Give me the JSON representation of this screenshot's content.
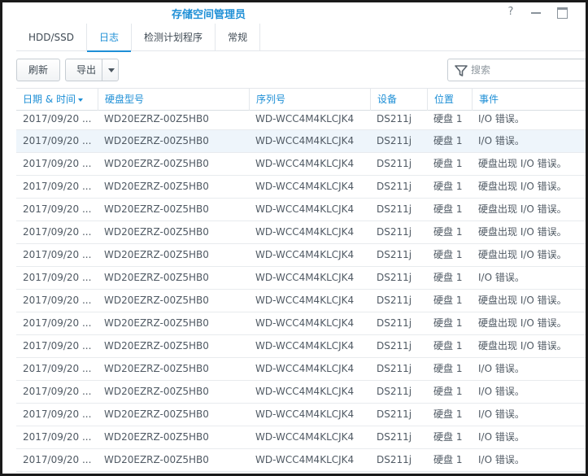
{
  "window": {
    "title": "存储空间管理员",
    "help_glyph": "?"
  },
  "tabs": [
    {
      "label": "HDD/SSD",
      "active": false
    },
    {
      "label": "日志",
      "active": true
    },
    {
      "label": "检测计划程序",
      "active": false
    },
    {
      "label": "常规",
      "active": false
    }
  ],
  "toolbar": {
    "refresh_label": "刷新",
    "export_label": "导出",
    "search_placeholder": "搜索"
  },
  "table": {
    "columns": [
      "日期 & 时间",
      "硬盘型号",
      "序列号",
      "设备",
      "位置",
      "事件"
    ],
    "sorted_column": 0,
    "rows": [
      [
        "2017/09/20 ...",
        "WD20EZRZ-00Z5HB0",
        "WD-WCC4M4KLCJK4",
        "DS211j",
        "硬盘 1",
        "I/O 错误。"
      ],
      [
        "2017/09/20 ...",
        "WD20EZRZ-00Z5HB0",
        "WD-WCC4M4KLCJK4",
        "DS211j",
        "硬盘 1",
        "I/O 错误。"
      ],
      [
        "2017/09/20 ...",
        "WD20EZRZ-00Z5HB0",
        "WD-WCC4M4KLCJK4",
        "DS211j",
        "硬盘 1",
        "硬盘出现 I/O 错误。"
      ],
      [
        "2017/09/20 ...",
        "WD20EZRZ-00Z5HB0",
        "WD-WCC4M4KLCJK4",
        "DS211j",
        "硬盘 1",
        "硬盘出现 I/O 错误。"
      ],
      [
        "2017/09/20 ...",
        "WD20EZRZ-00Z5HB0",
        "WD-WCC4M4KLCJK4",
        "DS211j",
        "硬盘 1",
        "硬盘出现 I/O 错误。"
      ],
      [
        "2017/09/20 ...",
        "WD20EZRZ-00Z5HB0",
        "WD-WCC4M4KLCJK4",
        "DS211j",
        "硬盘 1",
        "硬盘出现 I/O 错误。"
      ],
      [
        "2017/09/20 ...",
        "WD20EZRZ-00Z5HB0",
        "WD-WCC4M4KLCJK4",
        "DS211j",
        "硬盘 1",
        "硬盘出现 I/O 错误。"
      ],
      [
        "2017/09/20 ...",
        "WD20EZRZ-00Z5HB0",
        "WD-WCC4M4KLCJK4",
        "DS211j",
        "硬盘 1",
        "I/O 错误。"
      ],
      [
        "2017/09/20 ...",
        "WD20EZRZ-00Z5HB0",
        "WD-WCC4M4KLCJK4",
        "DS211j",
        "硬盘 1",
        "硬盘出现 I/O 错误。"
      ],
      [
        "2017/09/20 ...",
        "WD20EZRZ-00Z5HB0",
        "WD-WCC4M4KLCJK4",
        "DS211j",
        "硬盘 1",
        "硬盘出现 I/O 错误。"
      ],
      [
        "2017/09/20 ...",
        "WD20EZRZ-00Z5HB0",
        "WD-WCC4M4KLCJK4",
        "DS211j",
        "硬盘 1",
        "硬盘出现 I/O 错误。"
      ],
      [
        "2017/09/20 ...",
        "WD20EZRZ-00Z5HB0",
        "WD-WCC4M4KLCJK4",
        "DS211j",
        "硬盘 1",
        "I/O 错误。"
      ],
      [
        "2017/09/20 ...",
        "WD20EZRZ-00Z5HB0",
        "WD-WCC4M4KLCJK4",
        "DS211j",
        "硬盘 1",
        "I/O 错误。"
      ],
      [
        "2017/09/20 ...",
        "WD20EZRZ-00Z5HB0",
        "WD-WCC4M4KLCJK4",
        "DS211j",
        "硬盘 1",
        "I/O 错误。"
      ],
      [
        "2017/09/20 ...",
        "WD20EZRZ-00Z5HB0",
        "WD-WCC4M4KLCJK4",
        "DS211j",
        "硬盘 1",
        "I/O 错误。"
      ],
      [
        "2017/09/20 ...",
        "WD20EZRZ-00Z5HB0",
        "WD-WCC4M4KLCJK4",
        "DS211j",
        "硬盘 1",
        "I/O 错误。"
      ]
    ],
    "highlighted_row": 1
  },
  "colors": {
    "accent": "#1e8fd6",
    "row_highlight": "#eef5fb"
  },
  "icons": {
    "help": "help-icon",
    "minimize": "minimize-icon",
    "maximize": "maximize-icon",
    "export_menu": "caret-down-icon",
    "filter": "filter-icon",
    "sort": "sort-desc-icon"
  }
}
